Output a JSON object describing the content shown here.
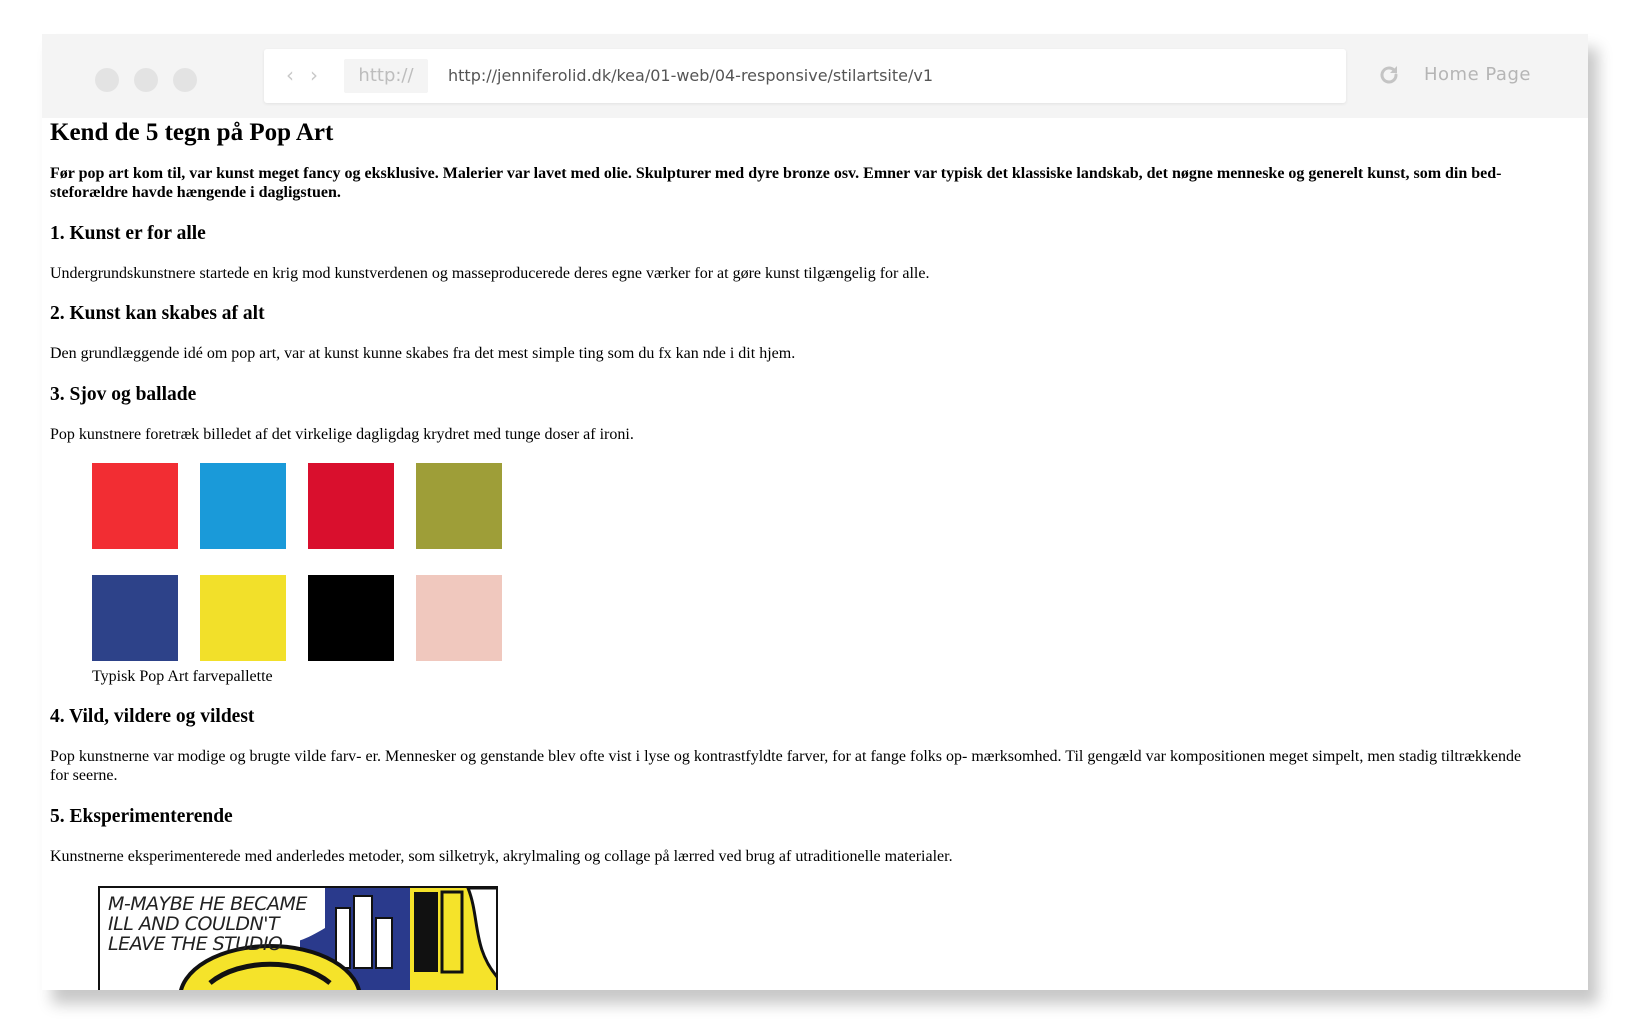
{
  "browser": {
    "protocol_label": "http://",
    "url": "http://jenniferolid.dk/kea/01-web/04-responsive/stilartsite/v1",
    "home_label": "Home Page",
    "nav_back_icon": "chevron-left-icon",
    "nav_forward_icon": "chevron-right-icon",
    "reload_icon": "reload-icon"
  },
  "page": {
    "title": "Kend de 5 tegn på Pop Art",
    "intro": "Før pop art kom til, var kunst meget fancy og eksklusive. Malerier var lavet med olie. Skulpturer med dyre bronze osv. Emner var typisk det klassiske landskab, det nøgne menneske og generelt kunst, som din bed- steforældre havde hængende i dagligstuen.",
    "sections": [
      {
        "heading": "1. Kunst er for alle",
        "text": "Undergrundskunstnere startede en krig mod kunstverdenen og masseproducerede deres egne værker for at gøre kunst tilgængelig for alle."
      },
      {
        "heading": "2. Kunst kan skabes af alt",
        "text": "Den grundlæggende idé om pop art, var at kunst kunne skabes fra det mest simple ting som du fx kan nde i dit hjem."
      },
      {
        "heading": "3. Sjov og ballade",
        "text": "Pop kunstnere foretræk billedet af det virkelige dagligdag krydret med tunge doser af ironi."
      },
      {
        "heading": "4. Vild, vildere og vildest",
        "text": "Pop kunstnerne var modige og brugte vilde farv- er. Mennesker og genstande blev ofte vist i lyse og kontrastfyldte farver, for at fange folks op- mærksomhed. Til gengæld var kompositionen meget simpelt, men stadig tiltrækkende for seerne."
      },
      {
        "heading": "5. Eksperimenterende",
        "text": "Kunstnerne eksperimenterede med anderledes metoder, som silketryk, akrylmaling og collage på lærred ved brug af utraditionelle materialer."
      }
    ],
    "palette": {
      "caption": "Typisk Pop Art farvepallette",
      "colors": [
        "#f22d33",
        "#1a9ad9",
        "#d90f2d",
        "#9e9e38",
        "#2d4289",
        "#f2e02a",
        "#000000",
        "#f0c8be"
      ]
    },
    "artwork": {
      "speech_text": "M-MAYBE HE BECAME ILL AND COULDN'T LEAVE THE STUDIO",
      "colors": {
        "sky": "#2a3a8c",
        "yellow": "#f5e32a",
        "black": "#111111",
        "white": "#ffffff"
      }
    }
  }
}
